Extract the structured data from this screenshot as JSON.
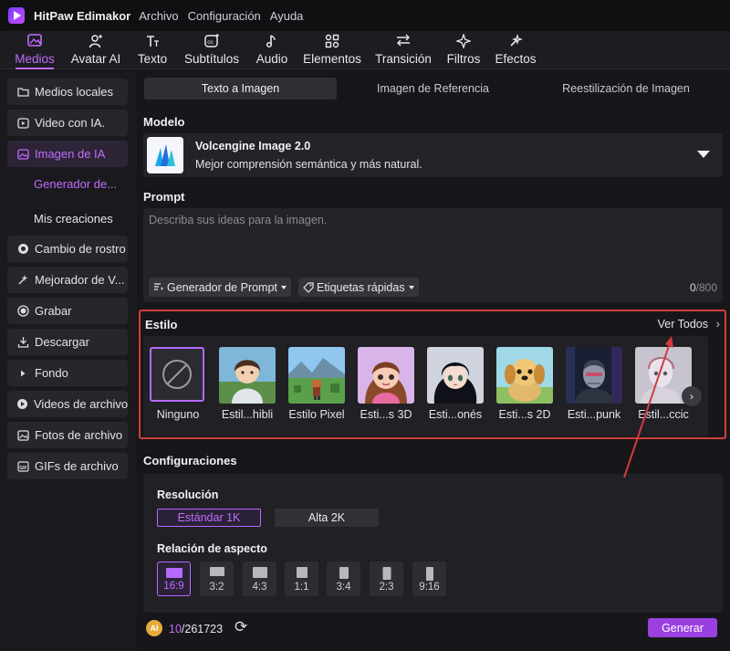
{
  "app": {
    "name": "HitPaw Edimakor"
  },
  "menu": [
    "Archivo",
    "Configuración",
    "Ayuda"
  ],
  "toolbar": [
    {
      "label": "Medios",
      "icon": "media-icon",
      "active": true
    },
    {
      "label": "Avatar AI",
      "icon": "avatar-icon"
    },
    {
      "label": "Texto",
      "icon": "text-icon"
    },
    {
      "label": "Subtítulos",
      "icon": "subtitles-icon"
    },
    {
      "label": "Audio",
      "icon": "audio-icon"
    },
    {
      "label": "Elementos",
      "icon": "elements-icon"
    },
    {
      "label": "Transición",
      "icon": "transition-icon"
    },
    {
      "label": "Filtros",
      "icon": "filters-icon"
    },
    {
      "label": "Efectos",
      "icon": "effects-icon"
    }
  ],
  "sidebar": {
    "items": [
      {
        "label": "Medios locales",
        "icon": "folder-icon"
      },
      {
        "label": "Video con IA.",
        "icon": "video-ai-icon"
      },
      {
        "label": "Imagen de IA",
        "icon": "image-ai-icon",
        "active": true
      },
      {
        "label": "Cambio de rostro",
        "icon": "face-swap-icon"
      },
      {
        "label": "Mejorador de V...",
        "icon": "enhancer-icon"
      },
      {
        "label": "Grabar",
        "icon": "record-icon"
      },
      {
        "label": "Descargar",
        "icon": "download-icon"
      },
      {
        "label": "Fondo",
        "icon": "background-icon"
      },
      {
        "label": "Videos de archivo",
        "icon": "stock-video-icon"
      },
      {
        "label": "Fotos de archivo",
        "icon": "stock-photo-icon"
      },
      {
        "label": "GIFs de archivo",
        "icon": "gif-icon"
      }
    ],
    "subitems": [
      {
        "label": "Generador de...",
        "active": true
      },
      {
        "label": "Mis creaciones"
      }
    ]
  },
  "tabs": [
    {
      "label": "Texto a Imagen",
      "active": true
    },
    {
      "label": "Imagen de Referencia"
    },
    {
      "label": "Reestilización de Imagen"
    }
  ],
  "model": {
    "section_label": "Modelo",
    "name": "Volcengine Image 2.0",
    "description": "Mejor comprensión semántica y más natural."
  },
  "prompt": {
    "section_label": "Prompt",
    "placeholder": "Describa sus ideas para la imagen.",
    "generator_button": "Generador de Prompt",
    "tags_button": "Etiquetas rápidas",
    "count": "0",
    "max": "/800"
  },
  "style": {
    "section_label": "Estilo",
    "see_all": "Ver Todos",
    "items": [
      {
        "label": "Ninguno",
        "selected": true
      },
      {
        "label": "Estil...hibli"
      },
      {
        "label": "Estilo Pixel"
      },
      {
        "label": "Esti...s 3D"
      },
      {
        "label": "Esti...onés"
      },
      {
        "label": "Esti...s 2D"
      },
      {
        "label": "Esti...punk"
      },
      {
        "label": "Estil...ccic"
      }
    ]
  },
  "config": {
    "section_label": "Configuraciones",
    "resolution_label": "Resolución",
    "resolutions": [
      {
        "label": "Estándar 1K",
        "active": true
      },
      {
        "label": "Alta 2K"
      }
    ],
    "aspect_label": "Relación de aspecto",
    "aspects": [
      {
        "label": "16:9",
        "active": true
      },
      {
        "label": "3:2"
      },
      {
        "label": "4:3"
      },
      {
        "label": "1:1"
      },
      {
        "label": "3:4"
      },
      {
        "label": "2:3"
      },
      {
        "label": "9:16"
      }
    ]
  },
  "footer": {
    "credit_used": "10",
    "credit_total": "/261723",
    "generate_button": "Generar"
  },
  "colors": {
    "accent": "#c26bff",
    "highlight_border": "#d23c3c",
    "generate": "#9b3fe0"
  }
}
